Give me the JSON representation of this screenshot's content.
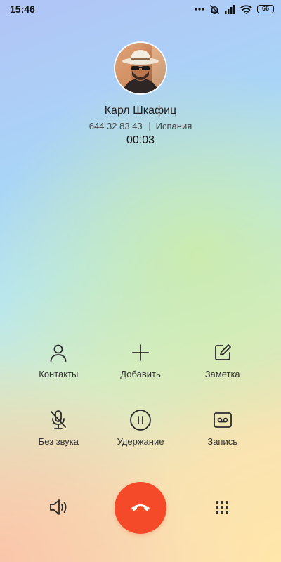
{
  "status_bar": {
    "time": "15:46",
    "battery_level": "66",
    "icons": [
      "more-dots-icon",
      "alarm-off-icon",
      "signal-icon",
      "wifi-icon",
      "battery-icon"
    ]
  },
  "call": {
    "contact_name": "Карл Шкафиц",
    "phone_number": "644 32 83 43",
    "location": "Испания",
    "duration": "00:03",
    "avatar_icon": "contact-photo"
  },
  "actions": [
    {
      "label": "Контакты",
      "icon": "person-icon"
    },
    {
      "label": "Добавить",
      "icon": "plus-icon"
    },
    {
      "label": "Заметка",
      "icon": "note-edit-icon"
    },
    {
      "label": "Без звука",
      "icon": "mic-off-icon"
    },
    {
      "label": "Удержание",
      "icon": "pause-icon"
    },
    {
      "label": "Запись",
      "icon": "record-icon"
    }
  ],
  "bottom_controls": {
    "speaker_icon": "speaker-icon",
    "end_call_icon": "end-call-icon",
    "keypad_icon": "dialpad-icon"
  },
  "colors": {
    "end_call": "#f44a2a",
    "icon_stroke": "#2a2a2a"
  }
}
